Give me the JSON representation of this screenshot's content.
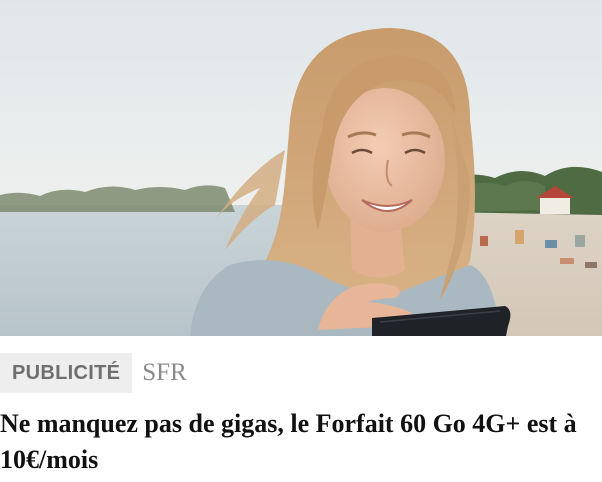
{
  "ad": {
    "image_alt": "Jeune femme souriante consultant son smartphone sur une plage",
    "badge_label": "PUBLICITÉ",
    "sponsor_name": "SFR",
    "headline": "Ne manquez pas de gigas, le Forfait 60 Go 4G+ est à 10€/mois"
  }
}
